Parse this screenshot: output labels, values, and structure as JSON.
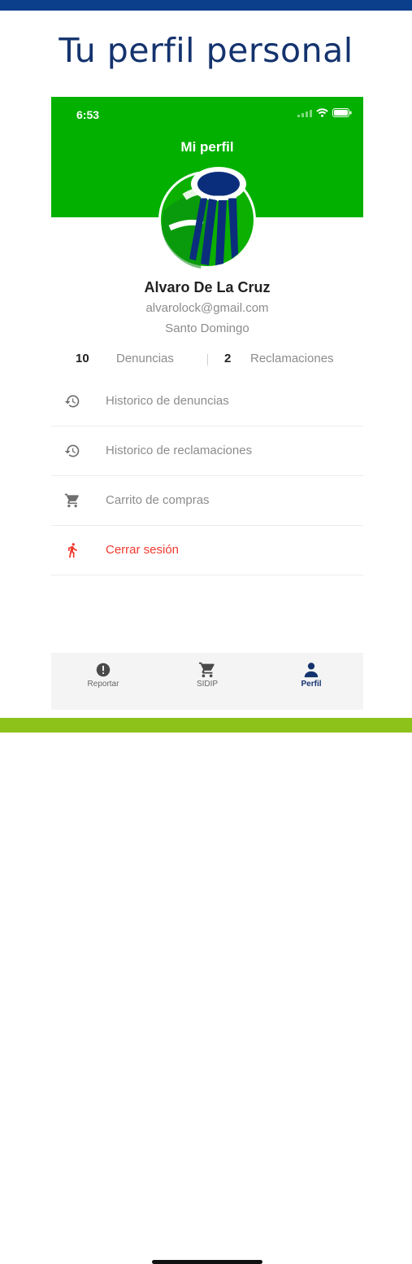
{
  "headline": "Tu perfil personal",
  "status_bar": {
    "time": "6:53"
  },
  "screen_title": "Mi perfil",
  "profile": {
    "name": "Alvaro De La Cruz",
    "email": "alvarolock@gmail.com",
    "city": "Santo Domingo"
  },
  "stats": [
    {
      "count": "10",
      "label": "Denuncias"
    },
    {
      "count": "2",
      "label": "Reclamaciones"
    }
  ],
  "menu": [
    {
      "label": "Historico de denuncias",
      "icon": "history-icon"
    },
    {
      "label": "Historico de reclamaciones",
      "icon": "history-icon"
    },
    {
      "label": "Carrito de compras",
      "icon": "cart-icon"
    },
    {
      "label": "Cerrar sesión",
      "icon": "running-person-icon"
    }
  ],
  "tabs": [
    {
      "label": "Reportar",
      "icon": "alert-circle-icon"
    },
    {
      "label": "SIDIP",
      "icon": "cart-icon"
    },
    {
      "label": "Perfil",
      "icon": "person-icon",
      "active": true
    }
  ],
  "colors": {
    "header_green": "#02b000",
    "headline_navy": "#14336e",
    "top_bar": "#0b3f8c",
    "bottom_bar": "#8dc21b",
    "logout_red": "#f03a2e"
  }
}
